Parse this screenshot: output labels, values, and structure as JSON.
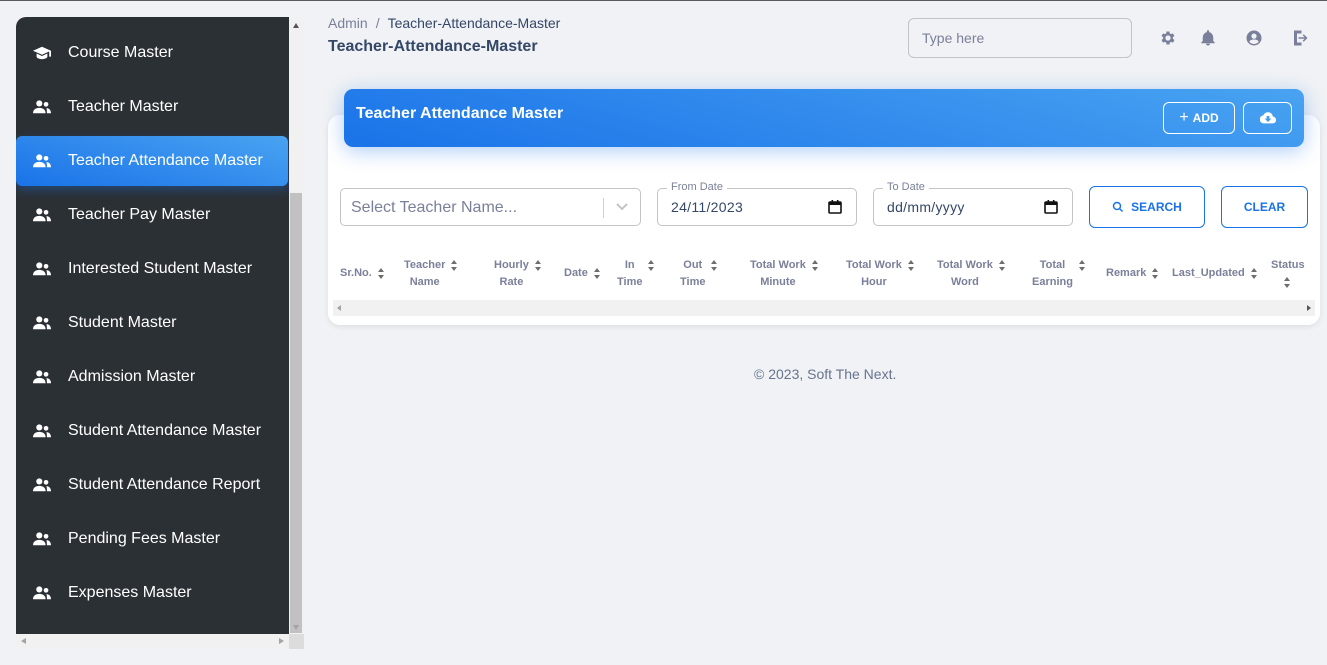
{
  "sidebar": {
    "items": [
      {
        "label": "Course Master",
        "icon": "graduation-cap-icon"
      },
      {
        "label": "Teacher Master",
        "icon": "users-icon"
      },
      {
        "label": "Teacher Attendance Master",
        "icon": "users-icon",
        "active": true
      },
      {
        "label": "Teacher Pay Master",
        "icon": "users-icon"
      },
      {
        "label": "Interested Student Master",
        "icon": "users-icon"
      },
      {
        "label": "Student Master",
        "icon": "users-icon"
      },
      {
        "label": "Admission Master",
        "icon": "users-icon"
      },
      {
        "label": "Student Attendance Master",
        "icon": "users-icon"
      },
      {
        "label": "Student Attendance Report",
        "icon": "users-icon"
      },
      {
        "label": "Pending Fees Master",
        "icon": "users-icon"
      },
      {
        "label": "Expenses Master",
        "icon": "users-icon"
      }
    ]
  },
  "header": {
    "breadcrumb_root": "Admin",
    "breadcrumb_sep": "/",
    "breadcrumb_current": "Teacher-Attendance-Master",
    "title": "Teacher-Attendance-Master",
    "search_placeholder": "Type here",
    "icons": [
      "gear-icon",
      "bell-icon",
      "user-circle-icon",
      "logout-icon"
    ]
  },
  "card": {
    "title": "Teacher Attendance Master",
    "add_label": "ADD",
    "accent_color": "#1a73e8"
  },
  "filters": {
    "teacher_placeholder": "Select Teacher Name...",
    "from_date_label": "From Date",
    "from_date_value": "24/11/2023",
    "to_date_label": "To Date",
    "to_date_value": "dd/mm/yyyy",
    "search_label": "SEARCH",
    "clear_label": "CLEAR"
  },
  "table": {
    "columns": [
      {
        "l1": "Sr.No.",
        "l2": ""
      },
      {
        "l1": "Teacher",
        "l2": "Name"
      },
      {
        "l1": "Hourly",
        "l2": "Rate"
      },
      {
        "l1": "Date",
        "l2": ""
      },
      {
        "l1": "In",
        "l2": "Time"
      },
      {
        "l1": "Out",
        "l2": "Time"
      },
      {
        "l1": "Total Work",
        "l2": "Minute"
      },
      {
        "l1": "Total Work",
        "l2": "Hour"
      },
      {
        "l1": "Total Work",
        "l2": "Word"
      },
      {
        "l1": "Total",
        "l2": "Earning"
      },
      {
        "l1": "Remark",
        "l2": ""
      },
      {
        "l1": "Last_Updated",
        "l2": ""
      },
      {
        "l1": "Status",
        "l2": ""
      }
    ],
    "rows": []
  },
  "footer": {
    "text": "© 2023, Soft The Next."
  }
}
